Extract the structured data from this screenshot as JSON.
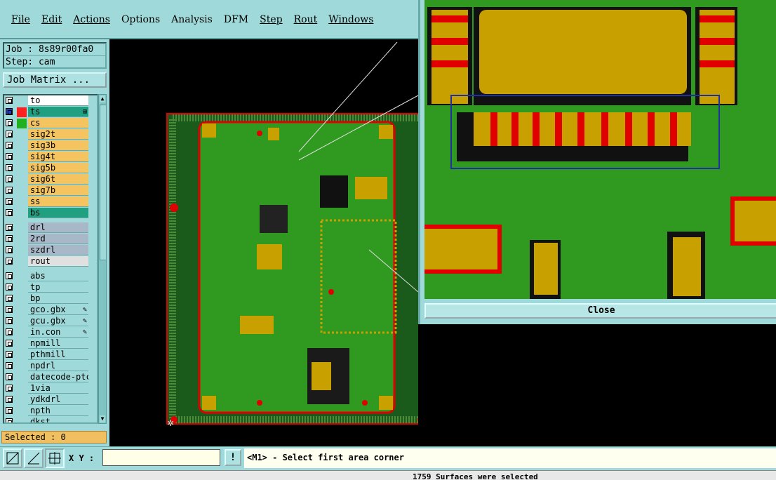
{
  "menu": {
    "items": [
      {
        "label": "File",
        "u": true
      },
      {
        "label": "Edit",
        "u": true
      },
      {
        "label": "Actions",
        "u": true
      },
      {
        "label": "Options",
        "u": false
      },
      {
        "label": "Analysis",
        "u": false
      },
      {
        "label": "DFM",
        "u": false
      },
      {
        "label": "Step",
        "u": true
      },
      {
        "label": "Rout",
        "u": true
      },
      {
        "label": "Windows",
        "u": true
      }
    ]
  },
  "job": {
    "job_line": "Job : 8s89r00fa0",
    "step_line": "Step: cam"
  },
  "job_matrix_label": "Job Matrix ...",
  "layers": [
    {
      "name": "to",
      "bg": "#ffffff",
      "swatch": ""
    },
    {
      "name": "ts",
      "bg": "#20a080",
      "swatch": "#ff2020",
      "active": true,
      "mark": "⊞"
    },
    {
      "name": "cs",
      "bg": "#f4c460",
      "swatch": "#20b020"
    },
    {
      "name": "sig2t",
      "bg": "#f4c460"
    },
    {
      "name": "sig3b",
      "bg": "#f4c460"
    },
    {
      "name": "sig4t",
      "bg": "#f4c460"
    },
    {
      "name": "sig5b",
      "bg": "#f4c460"
    },
    {
      "name": "sig6t",
      "bg": "#f4c460"
    },
    {
      "name": "sig7b",
      "bg": "#f4c460"
    },
    {
      "name": "ss",
      "bg": "#f4c460"
    },
    {
      "name": "bs",
      "bg": "#20a080",
      "gapAfter": true
    },
    {
      "name": "drl",
      "bg": "#a8b8c8"
    },
    {
      "name": "2rd",
      "bg": "#a8b8c8"
    },
    {
      "name": "szdrl",
      "bg": "#a8b8c8"
    },
    {
      "name": "rout",
      "bg": "#e0e0e0",
      "gapAfter": true
    },
    {
      "name": "abs",
      "bg": "#9fd9d9"
    },
    {
      "name": "tp",
      "bg": "#9fd9d9"
    },
    {
      "name": "bp",
      "bg": "#9fd9d9"
    },
    {
      "name": "gco.gbx",
      "bg": "#9fd9d9",
      "mark": "✎"
    },
    {
      "name": "gcu.gbx",
      "bg": "#9fd9d9",
      "mark": "✎"
    },
    {
      "name": "in.con",
      "bg": "#9fd9d9",
      "mark": "✎"
    },
    {
      "name": "npmill",
      "bg": "#9fd9d9"
    },
    {
      "name": "pthmill",
      "bg": "#9fd9d9"
    },
    {
      "name": "npdrl",
      "bg": "#9fd9d9"
    },
    {
      "name": "datecode-ptc",
      "bg": "#9fd9d9"
    },
    {
      "name": "1via",
      "bg": "#9fd9d9"
    },
    {
      "name": "ydkdrl",
      "bg": "#9fd9d9"
    },
    {
      "name": "npth",
      "bg": "#9fd9d9"
    },
    {
      "name": "dkst",
      "bg": "#9fd9d9"
    }
  ],
  "selected_label": "Selected : 0",
  "close_label": "Close",
  "xy_label": "X Y :",
  "xy_value": "",
  "prompt_text": "<M1> - Select first area corner",
  "status_text": "1759 Surfaces were selected",
  "colors": {
    "board_green": "#2f9a1f",
    "copper": "#c8a000",
    "outline_red": "#e00000",
    "panel": "#9fd9d9"
  }
}
